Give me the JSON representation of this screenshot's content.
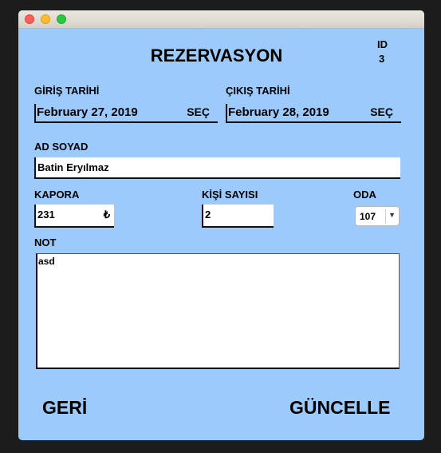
{
  "window": {
    "traffic_lights": [
      "close",
      "minimize",
      "maximize"
    ]
  },
  "form": {
    "title": "REZERVASYON",
    "id_label": "ID",
    "id_value": "3",
    "checkin": {
      "label": "GİRİŞ TARİHİ",
      "value": "February 27, 2019",
      "button": "SEÇ"
    },
    "checkout": {
      "label": "ÇIKIŞ TARİHİ",
      "value": "February 28, 2019",
      "button": "SEÇ"
    },
    "name": {
      "label": "AD SOYAD",
      "value": "Batin Eryılmaz"
    },
    "deposit": {
      "label": "KAPORA",
      "value": "231",
      "currency": "₺"
    },
    "guests": {
      "label": "KİŞİ SAYISI",
      "value": "2"
    },
    "room": {
      "label": "ODA",
      "value": "107"
    },
    "note": {
      "label": "NOT",
      "value": "asd"
    },
    "back_button": "GERİ",
    "update_button": "GÜNCELLE"
  }
}
